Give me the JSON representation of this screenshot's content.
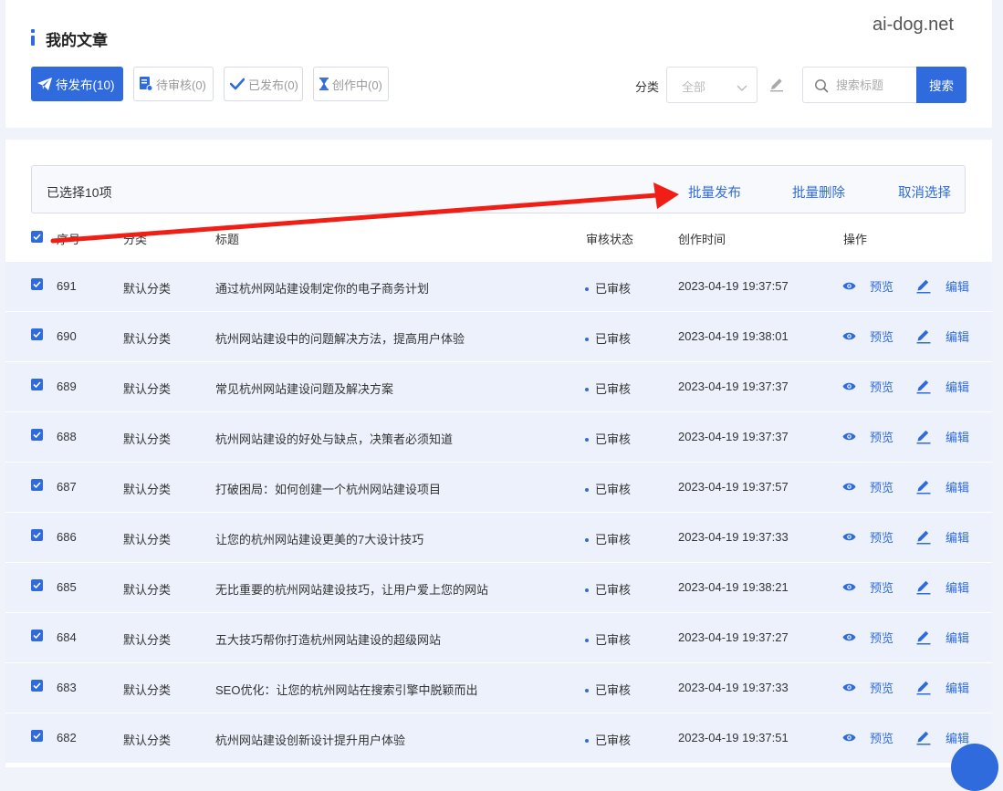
{
  "page_title": "我的文章",
  "watermark": "ai-dog.net",
  "tabs": [
    {
      "label": "待发布(10)",
      "icon": "paper-plane-icon",
      "active": true
    },
    {
      "label": "待审核(0)",
      "icon": "document-review-icon",
      "active": false
    },
    {
      "label": "已发布(0)",
      "icon": "checkmark-icon",
      "active": false
    },
    {
      "label": "创作中(0)",
      "icon": "hourglass-icon",
      "active": false
    }
  ],
  "filter": {
    "category_label": "分类",
    "category_value": "全部",
    "search_placeholder": "搜索标题",
    "search_button": "搜索"
  },
  "bulk": {
    "selected_text": "已选择10项",
    "publish": "批量发布",
    "delete": "批量删除",
    "cancel": "取消选择"
  },
  "columns": {
    "id": "序号",
    "category": "分类",
    "title": "标题",
    "status": "审核状态",
    "created": "创作时间",
    "actions": "操作"
  },
  "action_labels": {
    "preview": "预览",
    "edit": "编辑"
  },
  "rows": [
    {
      "id": "691",
      "category": "默认分类",
      "title": "通过杭州网站建设制定你的电子商务计划",
      "status": "已审核",
      "created": "2023-04-19 19:37:57"
    },
    {
      "id": "690",
      "category": "默认分类",
      "title": "杭州网站建设中的问题解决方法，提高用户体验",
      "status": "已审核",
      "created": "2023-04-19 19:38:01"
    },
    {
      "id": "689",
      "category": "默认分类",
      "title": "常见杭州网站建设问题及解决方案",
      "status": "已审核",
      "created": "2023-04-19 19:37:37"
    },
    {
      "id": "688",
      "category": "默认分类",
      "title": "杭州网站建设的好处与缺点，决策者必须知道",
      "status": "已审核",
      "created": "2023-04-19 19:37:37"
    },
    {
      "id": "687",
      "category": "默认分类",
      "title": "打破困局：如何创建一个杭州网站建设项目",
      "status": "已审核",
      "created": "2023-04-19 19:37:57"
    },
    {
      "id": "686",
      "category": "默认分类",
      "title": "让您的杭州网站建设更美的7大设计技巧",
      "status": "已审核",
      "created": "2023-04-19 19:37:33"
    },
    {
      "id": "685",
      "category": "默认分类",
      "title": "无比重要的杭州网站建设技巧，让用户爱上您的网站",
      "status": "已审核",
      "created": "2023-04-19 19:38:21"
    },
    {
      "id": "684",
      "category": "默认分类",
      "title": "五大技巧帮你打造杭州网站建设的超级网站",
      "status": "已审核",
      "created": "2023-04-19 19:37:27"
    },
    {
      "id": "683",
      "category": "默认分类",
      "title": "SEO优化：让您的杭州网站在搜索引擎中脱颖而出",
      "status": "已审核",
      "created": "2023-04-19 19:37:33"
    },
    {
      "id": "682",
      "category": "默认分类",
      "title": "杭州网站建设创新设计提升用户体验",
      "status": "已审核",
      "created": "2023-04-19 19:37:51"
    }
  ],
  "colors": {
    "accent": "#2f6bdc",
    "arrow": "#f01e14",
    "row_bg": "#ecf1fc"
  }
}
